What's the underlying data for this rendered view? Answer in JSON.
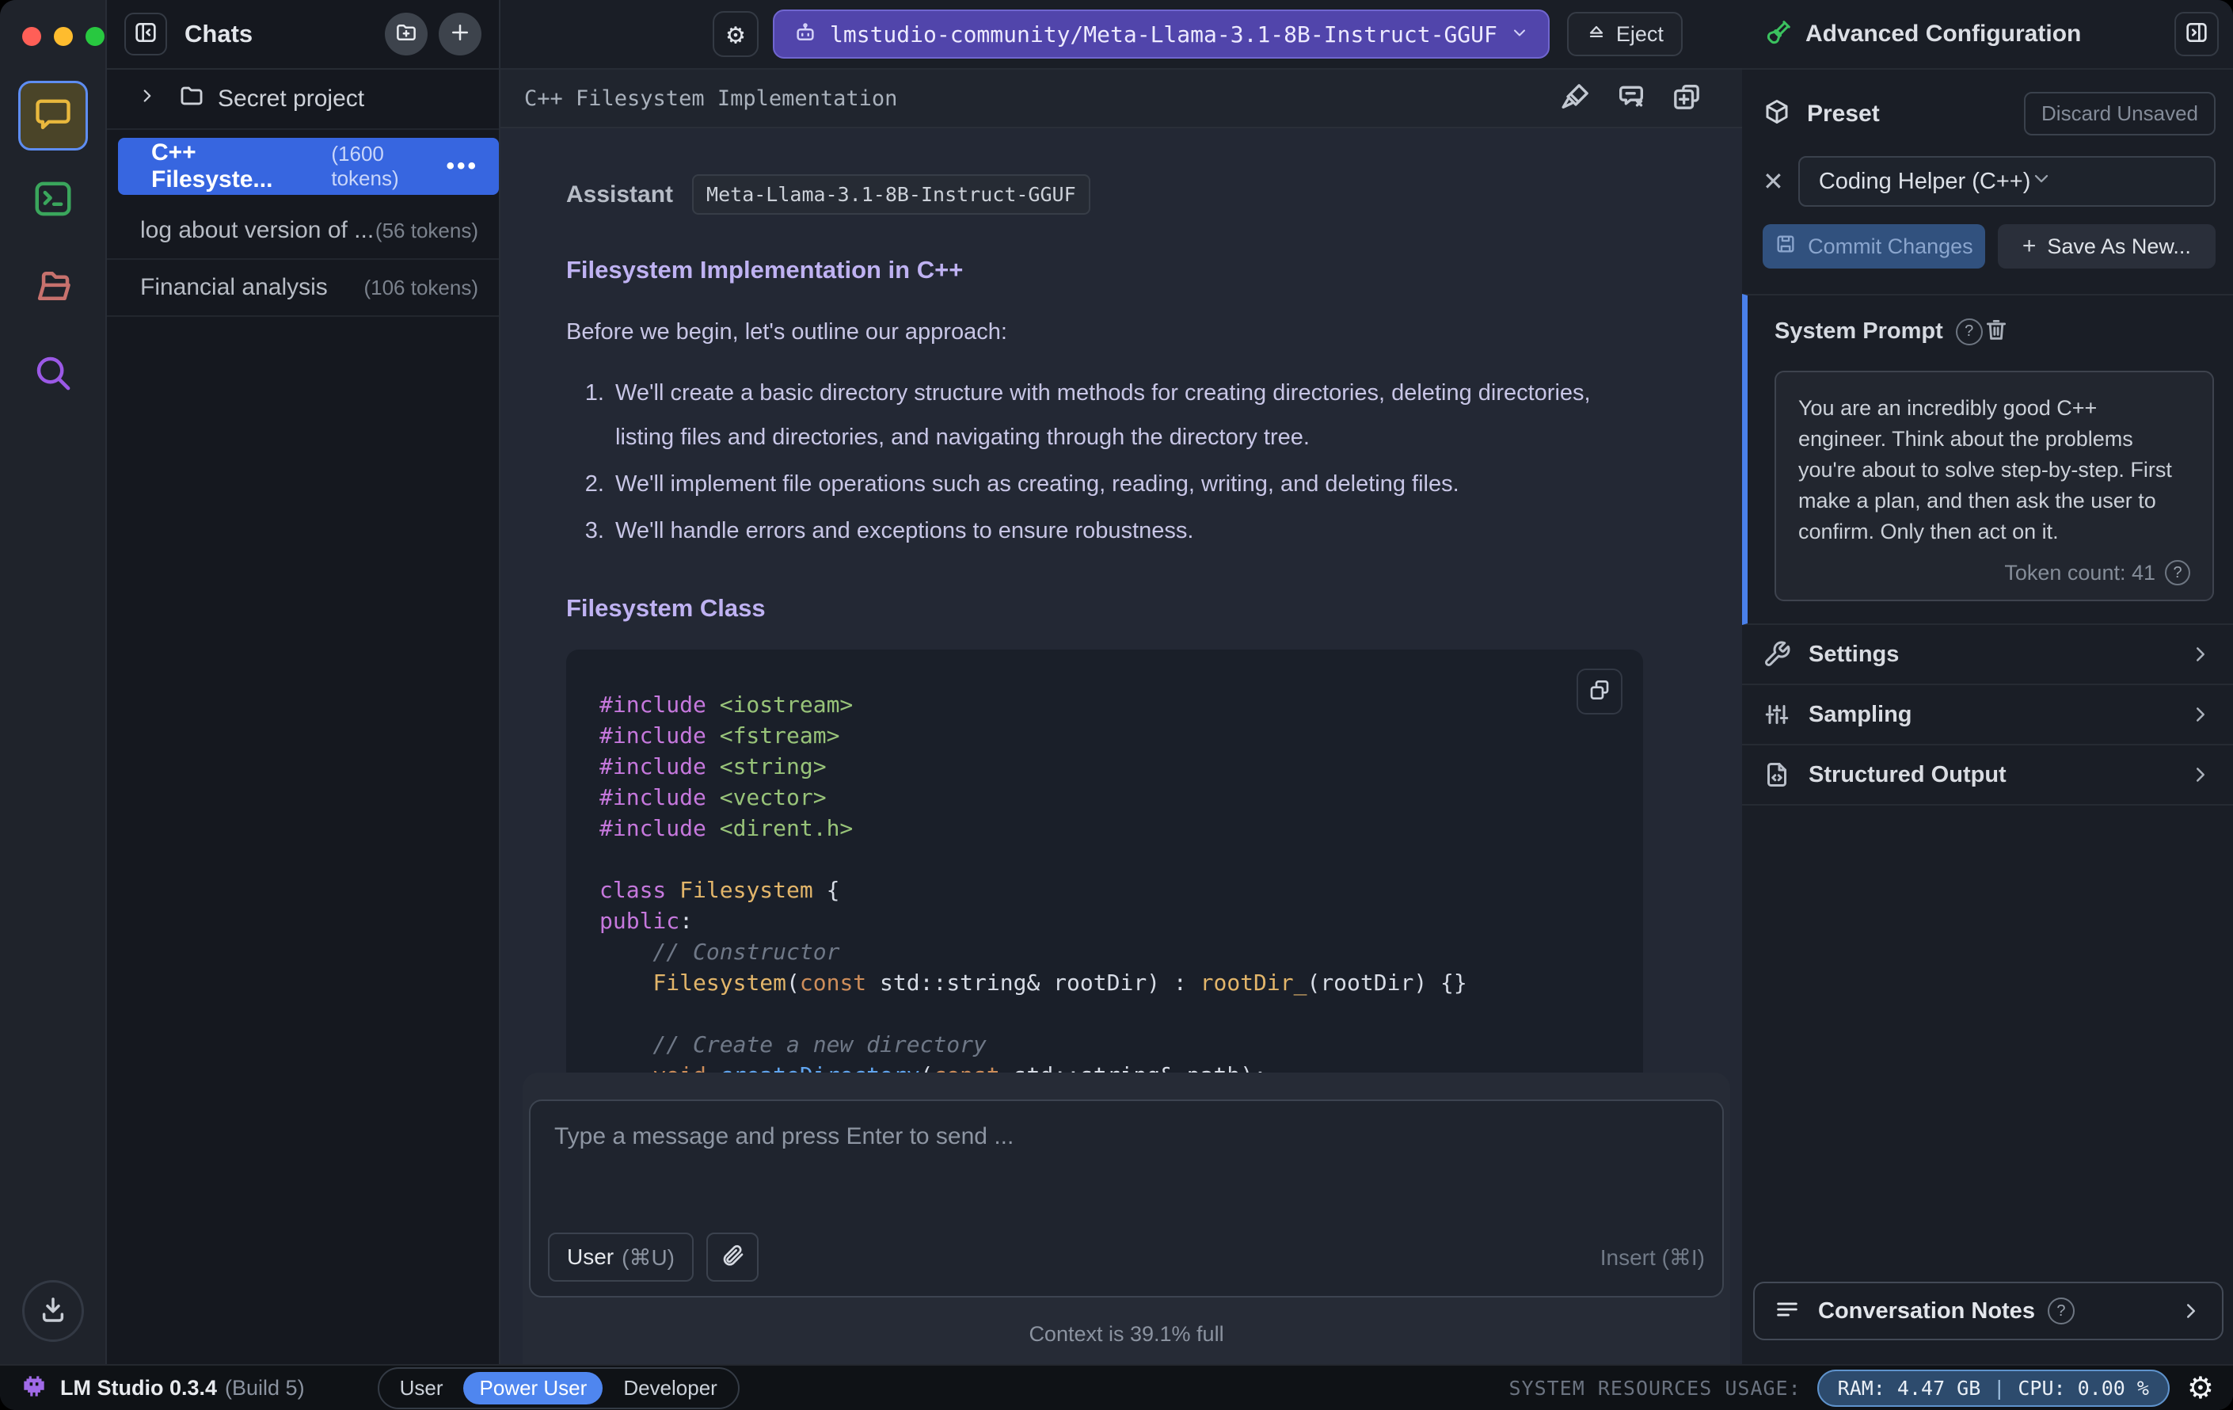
{
  "topbar": {
    "model": "lmstudio-community/Meta-Llama-3.1-8B-Instruct-GGUF",
    "eject_label": "Eject"
  },
  "sidebar": {
    "title": "Chats",
    "folder": "Secret project",
    "chats": [
      {
        "title": "C++ Filesyste...",
        "tokens": "(1600 tokens)",
        "selected": true,
        "menu": "•••"
      },
      {
        "title": "log about version of ...",
        "tokens": "(56 tokens)",
        "selected": false
      },
      {
        "title": "Financial analysis",
        "tokens": "(106 tokens)",
        "selected": false
      }
    ]
  },
  "chat": {
    "title": "C++ Filesystem Implementation",
    "assistant_label": "Assistant",
    "model_badge": "Meta-Llama-3.1-8B-Instruct-GGUF",
    "heading1": "Filesystem Implementation in C++",
    "paragraph": "Before we begin, let's outline our approach:",
    "list": [
      "We'll create a basic directory structure with methods for creating directories, deleting directories, listing files and directories, and navigating through the directory tree.",
      "We'll implement file operations such as creating, reading, writing, and deleting files.",
      "We'll handle errors and exceptions to ensure robustness."
    ],
    "heading2": "Filesystem Class",
    "code_lines": [
      [
        [
          "#include",
          "mag"
        ],
        [
          " ",
          ""
        ],
        [
          "<iostream>",
          "grn"
        ]
      ],
      [
        [
          "#include",
          "mag"
        ],
        [
          " ",
          ""
        ],
        [
          "<fstream>",
          "grn"
        ]
      ],
      [
        [
          "#include",
          "mag"
        ],
        [
          " ",
          ""
        ],
        [
          "<string>",
          "grn"
        ]
      ],
      [
        [
          "#include",
          "mag"
        ],
        [
          " ",
          ""
        ],
        [
          "<vector>",
          "grn"
        ]
      ],
      [
        [
          "#include",
          "mag"
        ],
        [
          " ",
          ""
        ],
        [
          "<dirent.h>",
          "grn"
        ]
      ],
      [],
      [
        [
          "class",
          "mag"
        ],
        [
          " ",
          ""
        ],
        [
          "Filesystem",
          "yel"
        ],
        [
          " {",
          ""
        ]
      ],
      [
        [
          "public",
          "mag"
        ],
        [
          ":",
          ""
        ]
      ],
      [
        [
          "    // Constructor",
          "com"
        ]
      ],
      [
        [
          "    ",
          ""
        ],
        [
          "Filesystem",
          "yel"
        ],
        [
          "(",
          ""
        ],
        [
          "const",
          "org"
        ],
        [
          " std::string& rootDir) : ",
          ""
        ],
        [
          "rootDir_",
          "yel"
        ],
        [
          "(rootDir) {}",
          ""
        ]
      ],
      [],
      [
        [
          "    // Create a new directory",
          "com"
        ]
      ],
      [
        [
          "    ",
          ""
        ],
        [
          "void",
          "org"
        ],
        [
          " ",
          ""
        ],
        [
          "createDirectory",
          "blu"
        ],
        [
          "(",
          ""
        ],
        [
          "const",
          "org"
        ],
        [
          " std::string& path);",
          ""
        ]
      ]
    ]
  },
  "composer": {
    "placeholder": "Type a message and press Enter to send ...",
    "role_button": "User",
    "role_shortcut": "(⌘U)",
    "insert_label": "Insert",
    "insert_shortcut": "(⌘I)",
    "context_status": "Context is 39.1% full"
  },
  "panel": {
    "title": "Advanced Configuration",
    "preset": {
      "label": "Preset",
      "discard": "Discard Unsaved",
      "value": "Coding Helper (C++)",
      "commit": "Commit Changes",
      "save_new": "Save As New...",
      "plus": "+",
      "clear": "✕"
    },
    "system_prompt": {
      "label": "System Prompt",
      "help": "?",
      "text": "You are an incredibly good C++ engineer. Think about the problems you're about to solve step-by-step. First make a plan, and then ask the user to confirm. Only then act on it.",
      "token_count": "Token count: 41"
    },
    "sections": [
      {
        "label": "Settings",
        "icon": "wrench-icon"
      },
      {
        "label": "Sampling",
        "icon": "sliders-icon"
      },
      {
        "label": "Structured Output",
        "icon": "file-code-icon"
      }
    ],
    "notes": "Conversation Notes",
    "notes_help": "?"
  },
  "statusbar": {
    "app": "LM Studio 0.3.4",
    "build": "(Build 5)",
    "modes": [
      "User",
      "Power User",
      "Developer"
    ],
    "active_mode": "Power User",
    "resources_label": "SYSTEM RESOURCES USAGE:",
    "ram": "RAM: 4.47 GB",
    "divider": "|",
    "cpu": "CPU: 0.00 %"
  },
  "colors": {
    "accent_blue": "#4a80ea",
    "selected_chat": "#3766e0",
    "model_pill": "#5145ab",
    "power_user_pill": "#4f86ef",
    "resource_pill_border": "#5f93cc",
    "rail_chat_icon": "#e9b83d",
    "rail_terminal_icon": "#3aa65c",
    "rail_folder_icon": "#c7716d",
    "rail_search_icon": "#9b59e6",
    "heading_purple": "#bfb2f2"
  }
}
